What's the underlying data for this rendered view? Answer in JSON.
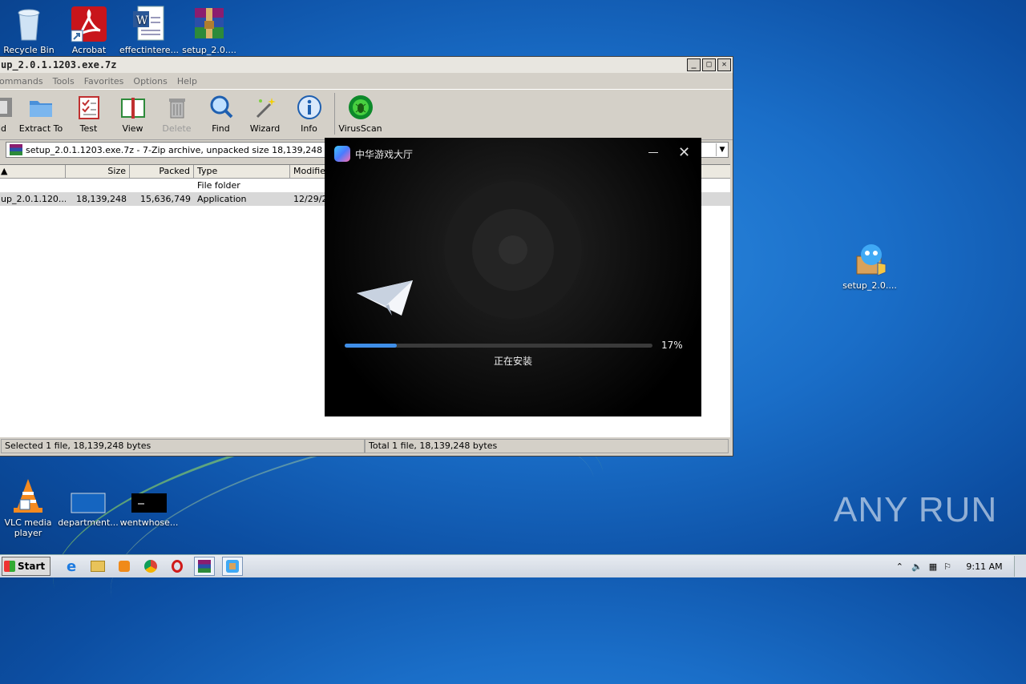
{
  "desktop": {
    "icons": [
      {
        "label": "Recycle Bin"
      },
      {
        "label": "Acrobat"
      },
      {
        "label": "effectintere..."
      },
      {
        "label": "setup_2.0...."
      },
      {
        "label": "setup_2.0...."
      },
      {
        "label": "VLC media player"
      },
      {
        "label": "department..."
      },
      {
        "label": "wentwhose..."
      }
    ],
    "watermark": "ANY RUN"
  },
  "zip_window": {
    "title": "up_2.0.1.1203.exe.7z",
    "menu": [
      "ommands",
      "Tools",
      "Favorites",
      "Options",
      "Help"
    ],
    "toolbar": [
      {
        "label": "ld",
        "icon": "add-icon",
        "enabled": true
      },
      {
        "label": "Extract To",
        "icon": "folder-icon",
        "enabled": true
      },
      {
        "label": "Test",
        "icon": "checklist-icon",
        "enabled": true
      },
      {
        "label": "View",
        "icon": "book-icon",
        "enabled": true
      },
      {
        "label": "Delete",
        "icon": "trash-icon",
        "enabled": false
      },
      {
        "label": "Find",
        "icon": "magnifier-icon",
        "enabled": true
      },
      {
        "label": "Wizard",
        "icon": "wand-icon",
        "enabled": true
      },
      {
        "label": "Info",
        "icon": "info-icon",
        "enabled": true
      },
      {
        "label": "VirusScan",
        "icon": "bug-icon",
        "enabled": true
      }
    ],
    "address": "setup_2.0.1.1203.exe.7z - 7-Zip archive, unpacked size 18,139,248 bytes",
    "columns": [
      "",
      "Size",
      "Packed",
      "Type",
      "Modified"
    ],
    "rows": [
      {
        "name": "",
        "size": "",
        "packed": "",
        "type": "File folder",
        "modified": ""
      },
      {
        "name": "up_2.0.1.120...",
        "size": "18,139,248",
        "packed": "15,636,749",
        "type": "Application",
        "modified": "12/29/2"
      }
    ],
    "status_left": "Selected 1 file, 18,139,248 bytes",
    "status_right": "Total 1 file, 18,139,248 bytes"
  },
  "installer": {
    "title": "中华游戏大厅",
    "progress": 17,
    "progress_label": "17%",
    "status": "正在安装"
  },
  "taskbar": {
    "start_label": "Start",
    "clock": "9:11 AM"
  }
}
